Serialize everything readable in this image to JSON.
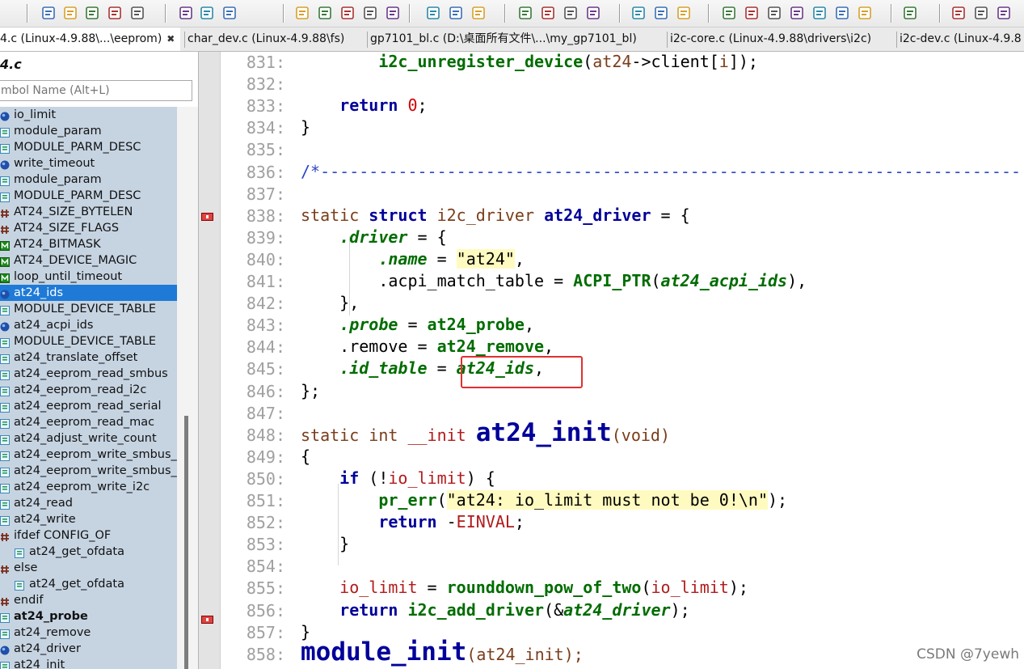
{
  "toolbar": {
    "buttons": [
      "new-file",
      "open-folder",
      "save",
      "save-all",
      "close-file",
      "cut",
      "copy",
      "paste",
      "find",
      "jump-prev",
      "jump-next",
      "replace",
      "toggle-mode",
      "mark-prev",
      "mark-next",
      "go-line",
      "bookmark",
      "dictionary",
      "book",
      "jump-tag",
      "layout-a",
      "layout-b",
      "layout-c",
      "project",
      "browse",
      "tree",
      "file-list",
      "sync",
      "tile",
      "refresh",
      "bird",
      "plus-minus",
      "expand",
      "collapse"
    ]
  },
  "tabs": [
    {
      "label": "4.c (Linux-4.9.88\\...\\eeprom)",
      "close": "✖",
      "active": true
    },
    {
      "label": "char_dev.c (Linux-4.9.88\\fs)",
      "active": false
    },
    {
      "label": "gp7101_bl.c (D:\\桌面所有文件\\...\\my_gp7101_bl)",
      "active": false
    },
    {
      "label": "i2c-core.c (Linux-4.9.88\\drivers\\i2c)",
      "active": false
    },
    {
      "label": "i2c-dev.c (Linux-4.9.8",
      "active": false
    }
  ],
  "sidebar": {
    "file_title": "4.c",
    "search_placeholder": "mbol Name (Alt+L)",
    "symbols": [
      {
        "label": "io_limit",
        "icon": "globe"
      },
      {
        "label": "module_param",
        "icon": "func"
      },
      {
        "label": "MODULE_PARM_DESC",
        "icon": "func"
      },
      {
        "label": "write_timeout",
        "icon": "globe"
      },
      {
        "label": "module_param",
        "icon": "func"
      },
      {
        "label": "MODULE_PARM_DESC",
        "icon": "func"
      },
      {
        "label": "AT24_SIZE_BYTELEN",
        "icon": "hash"
      },
      {
        "label": "AT24_SIZE_FLAGS",
        "icon": "hash"
      },
      {
        "label": "AT24_BITMASK",
        "icon": "macro"
      },
      {
        "label": "AT24_DEVICE_MAGIC",
        "icon": "macro"
      },
      {
        "label": "loop_until_timeout",
        "icon": "macro"
      },
      {
        "label": "at24_ids",
        "icon": "globe",
        "selected": true
      },
      {
        "label": "MODULE_DEVICE_TABLE",
        "icon": "func"
      },
      {
        "label": "at24_acpi_ids",
        "icon": "globe"
      },
      {
        "label": "MODULE_DEVICE_TABLE",
        "icon": "func"
      },
      {
        "label": "at24_translate_offset",
        "icon": "func"
      },
      {
        "label": "at24_eeprom_read_smbus",
        "icon": "func"
      },
      {
        "label": "at24_eeprom_read_i2c",
        "icon": "func"
      },
      {
        "label": "at24_eeprom_read_serial",
        "icon": "func"
      },
      {
        "label": "at24_eeprom_read_mac",
        "icon": "func"
      },
      {
        "label": "at24_adjust_write_count",
        "icon": "func"
      },
      {
        "label": "at24_eeprom_write_smbus_",
        "icon": "func"
      },
      {
        "label": "at24_eeprom_write_smbus_",
        "icon": "func"
      },
      {
        "label": "at24_eeprom_write_i2c",
        "icon": "func"
      },
      {
        "label": "at24_read",
        "icon": "func"
      },
      {
        "label": "at24_write",
        "icon": "func"
      },
      {
        "label": "ifdef CONFIG_OF",
        "icon": "hash"
      },
      {
        "label": "at24_get_ofdata",
        "icon": "func",
        "indent": true
      },
      {
        "label": "else",
        "icon": "hash"
      },
      {
        "label": "at24_get_ofdata",
        "icon": "func",
        "indent": true
      },
      {
        "label": "endif",
        "icon": "hash"
      },
      {
        "label": "at24_probe",
        "icon": "func",
        "bold": true
      },
      {
        "label": "at24_remove",
        "icon": "func"
      },
      {
        "label": "at24_driver",
        "icon": "globe"
      },
      {
        "label": "at24_init",
        "icon": "func"
      }
    ]
  },
  "editor": {
    "lines": [
      {
        "n": "831:",
        "segs": [
          [
            "f",
            "        i2c_unregister_device"
          ],
          [
            "",
            "("
          ],
          [
            "t",
            "at24"
          ],
          [
            "",
            "->client["
          ],
          [
            "t",
            "i"
          ],
          [
            "",
            "]);"
          ]
        ]
      },
      {
        "n": "832:",
        "segs": []
      },
      {
        "n": "833:",
        "segs": [
          [
            "k",
            "    return"
          ],
          [
            "",
            " "
          ],
          [
            "n",
            "0"
          ],
          [
            "",
            ";"
          ]
        ]
      },
      {
        "n": "834:",
        "segs": [
          [
            "",
            "}"
          ]
        ]
      },
      {
        "n": "835:",
        "segs": []
      },
      {
        "n": "836:",
        "segs": [
          [
            "cm",
            "/*------------------------------------------------------------------------"
          ]
        ]
      },
      {
        "n": "837:",
        "segs": []
      },
      {
        "n": "838:",
        "segs": [
          [
            "t",
            "static"
          ],
          [
            "",
            " "
          ],
          [
            "k",
            "struct"
          ],
          [
            "",
            " "
          ],
          [
            "t",
            "i2c_driver"
          ],
          [
            "",
            " "
          ],
          [
            "k",
            "at24_driver"
          ],
          [
            "",
            " = {"
          ]
        ]
      },
      {
        "n": "839:",
        "segs": [
          [
            "m",
            "    .driver"
          ],
          [
            "",
            " = {"
          ]
        ]
      },
      {
        "n": "840:",
        "segs": [
          [
            "m",
            "        .name"
          ],
          [
            "",
            " = "
          ],
          [
            "s",
            "\"at24\""
          ],
          [
            "",
            ","
          ]
        ]
      },
      {
        "n": "841:",
        "segs": [
          [
            "",
            "        .acpi_match_table = "
          ],
          [
            "f",
            "ACPI_PTR"
          ],
          [
            "",
            "("
          ],
          [
            "m",
            "at24_acpi_ids"
          ],
          [
            "",
            "),"
          ]
        ]
      },
      {
        "n": "842:",
        "segs": [
          [
            "",
            "    },"
          ]
        ]
      },
      {
        "n": "843:",
        "segs": [
          [
            "m",
            "    .probe"
          ],
          [
            "",
            " = "
          ],
          [
            "f",
            "at24_probe"
          ],
          [
            "",
            ","
          ]
        ]
      },
      {
        "n": "844:",
        "segs": [
          [
            "",
            "    .remove = "
          ],
          [
            "f",
            "at24_remove"
          ],
          [
            "",
            ","
          ]
        ]
      },
      {
        "n": "845:",
        "segs": [
          [
            "m",
            "    .id_table"
          ],
          [
            "",
            " = "
          ],
          [
            "m",
            "at24_ids"
          ],
          [
            "",
            ","
          ]
        ]
      },
      {
        "n": "846:",
        "segs": [
          [
            "",
            "};"
          ]
        ]
      },
      {
        "n": "847:",
        "segs": []
      },
      {
        "n": "848:",
        "segs": [
          [
            "t",
            "static"
          ],
          [
            "",
            " "
          ],
          [
            "t",
            "int"
          ],
          [
            "",
            " "
          ],
          [
            "v",
            "__init"
          ],
          [
            "",
            " "
          ],
          [
            "big",
            "at24_init"
          ],
          [
            "t",
            "(void)"
          ]
        ]
      },
      {
        "n": "849:",
        "segs": [
          [
            "",
            "{"
          ]
        ]
      },
      {
        "n": "850:",
        "segs": [
          [
            "k",
            "    if"
          ],
          [
            "",
            " (!"
          ],
          [
            "v",
            "io_limit"
          ],
          [
            "",
            ") {"
          ]
        ]
      },
      {
        "n": "851:",
        "segs": [
          [
            "f",
            "        pr_err"
          ],
          [
            "",
            "("
          ],
          [
            "s",
            "\"at24: io_limit must not be 0!\\n\""
          ],
          [
            "",
            ");"
          ]
        ]
      },
      {
        "n": "852:",
        "segs": [
          [
            "k",
            "        return"
          ],
          [
            "",
            " -"
          ],
          [
            "v",
            "EINVAL"
          ],
          [
            "",
            ";"
          ]
        ]
      },
      {
        "n": "853:",
        "segs": [
          [
            "",
            "    }"
          ]
        ]
      },
      {
        "n": "854:",
        "segs": []
      },
      {
        "n": "855:",
        "segs": [
          [
            "v",
            "    io_limit"
          ],
          [
            "",
            " = "
          ],
          [
            "f",
            "rounddown_pow_of_two"
          ],
          [
            "",
            "("
          ],
          [
            "v",
            "io_limit"
          ],
          [
            "",
            ");"
          ]
        ]
      },
      {
        "n": "856:",
        "segs": [
          [
            "k",
            "    return"
          ],
          [
            "",
            " "
          ],
          [
            "f",
            "i2c_add_driver"
          ],
          [
            "",
            "(&"
          ],
          [
            "m",
            "at24_driver"
          ],
          [
            "",
            ");"
          ]
        ]
      },
      {
        "n": "857:",
        "segs": [
          [
            "",
            "}"
          ]
        ]
      },
      {
        "n": "858:",
        "segs": [
          [
            "big",
            "module_init"
          ],
          [
            "sm",
            "(at24_init);"
          ]
        ]
      }
    ]
  },
  "watermark": "CSDN @7yewh",
  "colors": {
    "selection": "#1e7ad6",
    "symbol_bg": "#c6d4e2",
    "highlight_box": "#e03030",
    "string_bg": "#fffbc0"
  }
}
